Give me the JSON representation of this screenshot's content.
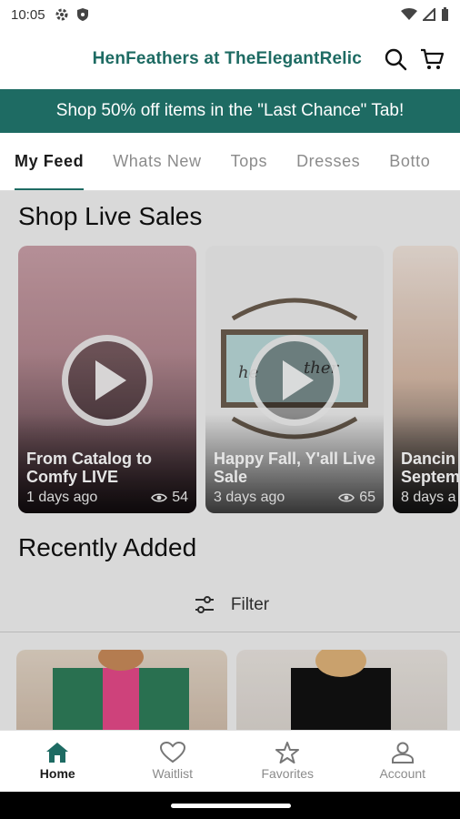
{
  "status_bar": {
    "time": "10:05"
  },
  "header": {
    "store_title": "HenFeathers at TheElegantRelic"
  },
  "promo": {
    "text": "Shop 50% off items in the \"Last Chance\" Tab!"
  },
  "tabs": [
    {
      "label": "My Feed",
      "active": true
    },
    {
      "label": "Whats New"
    },
    {
      "label": "Tops"
    },
    {
      "label": "Dresses"
    },
    {
      "label": "Botto"
    }
  ],
  "live_sales": {
    "title": "Shop Live Sales",
    "cards": [
      {
        "title": "From Catalog to Comfy LIVE",
        "age": "1 days ago",
        "views": "54"
      },
      {
        "title": "Happy Fall, Y'all Live Sale",
        "age": "3 days ago",
        "views": "65"
      },
      {
        "title": "Dancin Septem",
        "age": "8 days a",
        "views": ""
      }
    ]
  },
  "recently_added": {
    "title": "Recently Added",
    "filter_label": "Filter"
  },
  "bottom_nav": [
    {
      "label": "Home",
      "icon": "home-icon",
      "active": true
    },
    {
      "label": "Waitlist",
      "icon": "heart-icon"
    },
    {
      "label": "Favorites",
      "icon": "star-icon"
    },
    {
      "label": "Account",
      "icon": "person-icon"
    }
  ],
  "colors": {
    "brand": "#1e6b63",
    "background": "#ffffff"
  }
}
